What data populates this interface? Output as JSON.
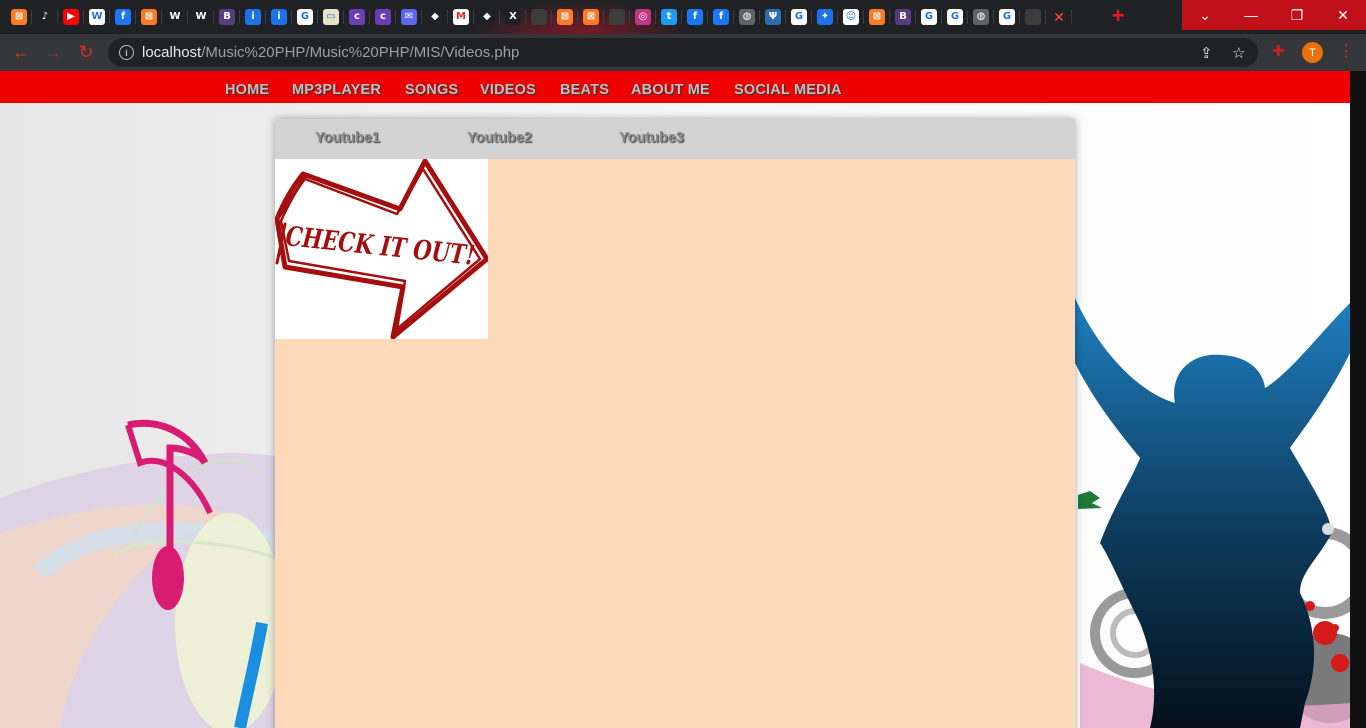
{
  "browser": {
    "tabs": [
      {
        "icon": "xampp-icon",
        "bg": "#fb7a24",
        "glyph": "⊠"
      },
      {
        "icon": "music-app-icon",
        "bg": "#202124",
        "glyph": "♪"
      },
      {
        "icon": "youtube-icon",
        "bg": "#ff0000",
        "glyph": "▶"
      },
      {
        "icon": "wordpress-icon",
        "bg": "#ffffff",
        "glyph": "W"
      },
      {
        "icon": "facebook-icon",
        "bg": "#1877f2",
        "glyph": "f"
      },
      {
        "icon": "xampp-icon",
        "bg": "#fb7a24",
        "glyph": "⊠"
      },
      {
        "icon": "webflow-icon",
        "bg": "#202124",
        "glyph": "W"
      },
      {
        "icon": "webflow-icon",
        "bg": "#202124",
        "glyph": "W"
      },
      {
        "icon": "bootstrap-icon",
        "bg": "#563d7c",
        "glyph": "B"
      },
      {
        "icon": "info-icon",
        "bg": "#1a73e8",
        "glyph": "i"
      },
      {
        "icon": "info-icon",
        "bg": "#1a73e8",
        "glyph": "i"
      },
      {
        "icon": "google-icon",
        "bg": "#ffffff",
        "glyph": "G"
      },
      {
        "icon": "page-icon",
        "bg": "#e8e3c8",
        "glyph": "▭"
      },
      {
        "icon": "colorlib-icon",
        "bg": "#6a3fb5",
        "glyph": "c"
      },
      {
        "icon": "colorlib-icon",
        "bg": "#6a3fb5",
        "glyph": "c"
      },
      {
        "icon": "mail-icon",
        "bg": "#5b67f0",
        "glyph": "✉"
      },
      {
        "icon": "stack-icon",
        "bg": "#202124",
        "glyph": "◆"
      },
      {
        "icon": "gmail-icon",
        "bg": "#ffffff",
        "glyph": "M"
      },
      {
        "icon": "stack-icon",
        "bg": "#202124",
        "glyph": "◆"
      },
      {
        "icon": "xt-icon",
        "bg": "#202124",
        "glyph": "X"
      },
      {
        "icon": "blank-tab-icon",
        "bg": "#3c3c3c",
        "glyph": ""
      },
      {
        "icon": "xampp-icon",
        "bg": "#fb7a24",
        "glyph": "⊠"
      },
      {
        "icon": "xampp-icon",
        "bg": "#fb7a24",
        "glyph": "⊠"
      },
      {
        "icon": "blank-tab-icon",
        "bg": "#3c3c3c",
        "glyph": ""
      },
      {
        "icon": "instagram-icon",
        "bg": "#c13584",
        "glyph": "◎"
      },
      {
        "icon": "twitter-icon",
        "bg": "#1d9bf0",
        "glyph": "t"
      },
      {
        "icon": "facebook-icon",
        "bg": "#1877f2",
        "glyph": "f"
      },
      {
        "icon": "facebook-icon",
        "bg": "#1877f2",
        "glyph": "f"
      },
      {
        "icon": "globe-icon",
        "bg": "#5f6368",
        "glyph": "◍"
      },
      {
        "icon": "psi-icon",
        "bg": "#2b6cb0",
        "glyph": "Ψ"
      },
      {
        "icon": "google-icon",
        "bg": "#ffffff",
        "glyph": "G"
      },
      {
        "icon": "diamond-icon",
        "bg": "#1a73e8",
        "glyph": "✦"
      },
      {
        "icon": "snapchat-icon",
        "bg": "#ffffff",
        "glyph": "☺"
      },
      {
        "icon": "xampp-icon",
        "bg": "#fb7a24",
        "glyph": "⊠"
      },
      {
        "icon": "bootstrap-icon",
        "bg": "#563d7c",
        "glyph": "B"
      },
      {
        "icon": "google-icon",
        "bg": "#ffffff",
        "glyph": "G"
      },
      {
        "icon": "google-icon",
        "bg": "#ffffff",
        "glyph": "G"
      },
      {
        "icon": "globe-icon",
        "bg": "#5f6368",
        "glyph": "◍"
      },
      {
        "icon": "google-icon",
        "bg": "#ffffff",
        "glyph": "G"
      },
      {
        "icon": "blank-tab-icon",
        "bg": "#3c3c3c",
        "glyph": ""
      }
    ],
    "url_host": "localhost",
    "url_path": "/Music%20PHP/Music%20PHP/MIS/Videos.php",
    "profile_initial": "T"
  },
  "nav": {
    "items": [
      {
        "label": "HOME"
      },
      {
        "label": "MP3PLAYER"
      },
      {
        "label": "SONGS"
      },
      {
        "label": "VIDEOS"
      },
      {
        "label": "BEATS"
      },
      {
        "label": "ABOUT ME"
      },
      {
        "label": "SOCIAL MEDIA"
      }
    ]
  },
  "subnav": {
    "items": [
      {
        "label": "Youtube1"
      },
      {
        "label": "Youtube2"
      },
      {
        "label": "Youtube3"
      }
    ]
  },
  "banner": {
    "text": "CHECK IT OUT!"
  },
  "colors": {
    "nav_red": "#ef0000",
    "content_bg": "#ffdab9",
    "subnav_bg": "#d3d3d3"
  }
}
